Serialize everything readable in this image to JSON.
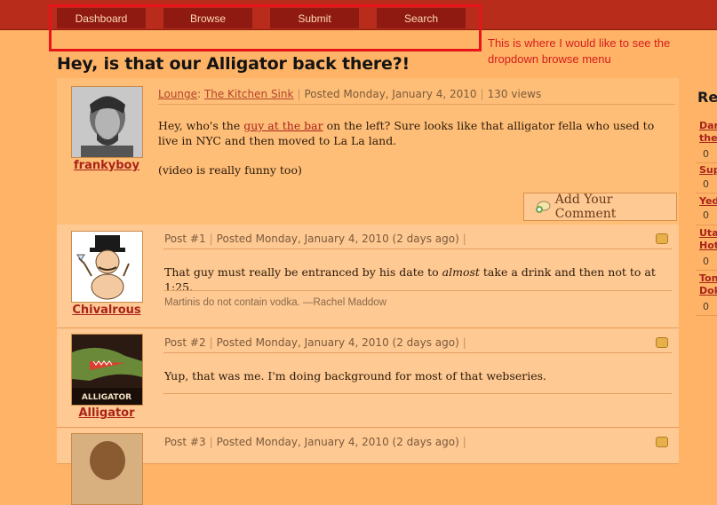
{
  "nav": {
    "items": [
      "Dashboard",
      "Browse",
      "Submit",
      "Search"
    ]
  },
  "annotation": {
    "text": "This is where I would like to see the dropdown browse menu"
  },
  "page": {
    "title": "Hey, is that our Alligator back there?!"
  },
  "first_post": {
    "author": "frankyboy",
    "category": "Lounge",
    "subcategory": "The Kitchen Sink",
    "posted": "Posted Monday, January 4, 2010",
    "views": "130 views",
    "body_before_link": "Hey, who's the ",
    "link_text": "guy at the bar",
    "body_after_link": " on the left? Sure looks like that alligator fella who used to live in NYC and then moved to La La land.",
    "body_line2": "(video is really funny too)",
    "add_comment": "Add Your Comment"
  },
  "replies": [
    {
      "number": "Post #1",
      "posted": "Posted Monday, January 4, 2010 (2 days ago)",
      "author": "Chivalrous",
      "body_before": "That guy must really be entranced by his date to ",
      "body_em": "almost",
      "body_after": " take a drink and then not to at 1:25.",
      "signature": "Martinis do not contain vodka. —Rachel Maddow"
    },
    {
      "number": "Post #2",
      "posted": "Posted Monday, January 4, 2010 (2 days ago)",
      "author": "Alligator",
      "body": "Yup, that was me. I'm doing background for most of that webseries."
    },
    {
      "number": "Post #3",
      "posted": "Posted Monday, January 4, 2010 (2 days ago)"
    }
  ],
  "related": {
    "title": "Rel",
    "items": [
      {
        "label": "Dar the",
        "count": "0"
      },
      {
        "label": "Sup",
        "count": "0"
      },
      {
        "label": "Yed",
        "count": "0"
      },
      {
        "label": "Uta Hot",
        "count": "0"
      },
      {
        "label": "Ton Dok",
        "count": "0"
      }
    ]
  },
  "colors": {
    "topbar": "#b82c1c",
    "nav_button": "#8f1a12",
    "background": "#ffb366",
    "annotation": "#e8141a"
  }
}
